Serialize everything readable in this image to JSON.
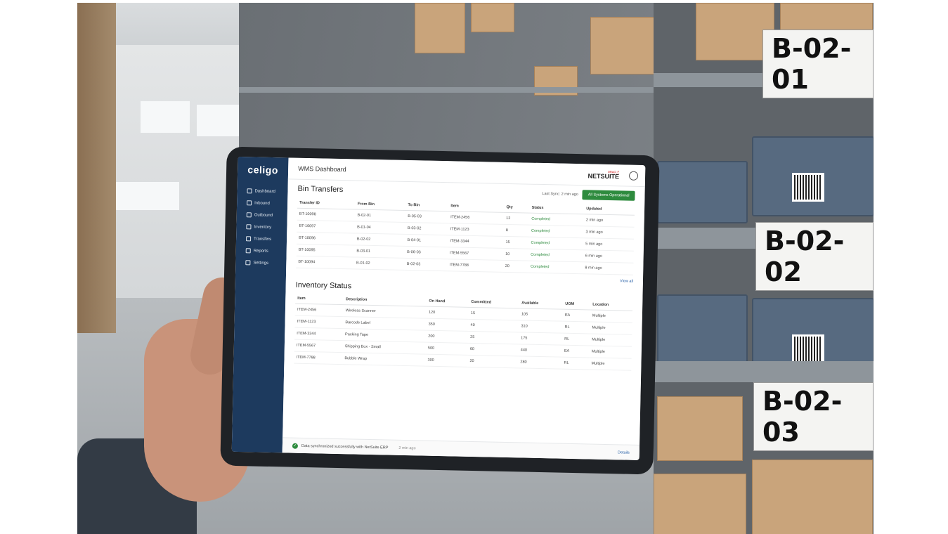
{
  "shelf_labels": [
    "B-02-01",
    "B-02-02",
    "B-02-03"
  ],
  "tablet": {
    "logo": "celigo",
    "nav": [
      "Dashboard",
      "Inbound",
      "Outbound",
      "Inventory",
      "Transfers",
      "Reports",
      "Settings"
    ],
    "app_title": "WMS Dashboard",
    "brand_small": "ORACLE",
    "brand": "NETSUITE",
    "bin_transfers": {
      "title": "Bin Transfers",
      "last_sync": "Last Sync: 2 min ago",
      "status": "All Systems Operational",
      "headers": [
        "Transfer ID",
        "From Bin",
        "To Bin",
        "Item",
        "Qty",
        "Status",
        "Updated"
      ],
      "rows": [
        [
          "BT-10098",
          "B-02-01",
          "B-05-03",
          "ITEM-2456",
          "12",
          "Completed",
          "2 min ago"
        ],
        [
          "BT-10097",
          "B-01-04",
          "B-03-02",
          "ITEM-1123",
          "8",
          "Completed",
          "3 min ago"
        ],
        [
          "BT-10096",
          "B-02-02",
          "B-04-01",
          "ITEM-3344",
          "15",
          "Completed",
          "5 min ago"
        ],
        [
          "BT-10095",
          "B-03-01",
          "B-06-03",
          "ITEM-5567",
          "10",
          "Completed",
          "6 min ago"
        ],
        [
          "BT-10094",
          "B-01-02",
          "B-02-03",
          "ITEM-7788",
          "20",
          "Completed",
          "8 min ago"
        ]
      ],
      "view_all": "View all"
    },
    "inventory": {
      "title": "Inventory Status",
      "headers": [
        "Item",
        "Description",
        "On Hand",
        "Committed",
        "Available",
        "UOM",
        "Location"
      ],
      "rows": [
        [
          "ITEM-2456",
          "Wireless Scanner",
          "120",
          "15",
          "105",
          "EA",
          "Multiple"
        ],
        [
          "ITEM-1123",
          "Barcode Label",
          "350",
          "40",
          "310",
          "RL",
          "Multiple"
        ],
        [
          "ITEM-3344",
          "Packing Tape",
          "200",
          "25",
          "175",
          "RL",
          "Multiple"
        ],
        [
          "ITEM-5567",
          "Shipping Box - Small",
          "500",
          "60",
          "440",
          "EA",
          "Multiple"
        ],
        [
          "ITEM-7788",
          "Bubble Wrap",
          "300",
          "20",
          "280",
          "RL",
          "Multiple"
        ]
      ]
    },
    "footer": {
      "message": "Data synchronized successfully with NetSuite ERP",
      "time": "2 min ago",
      "details": "Details"
    }
  }
}
